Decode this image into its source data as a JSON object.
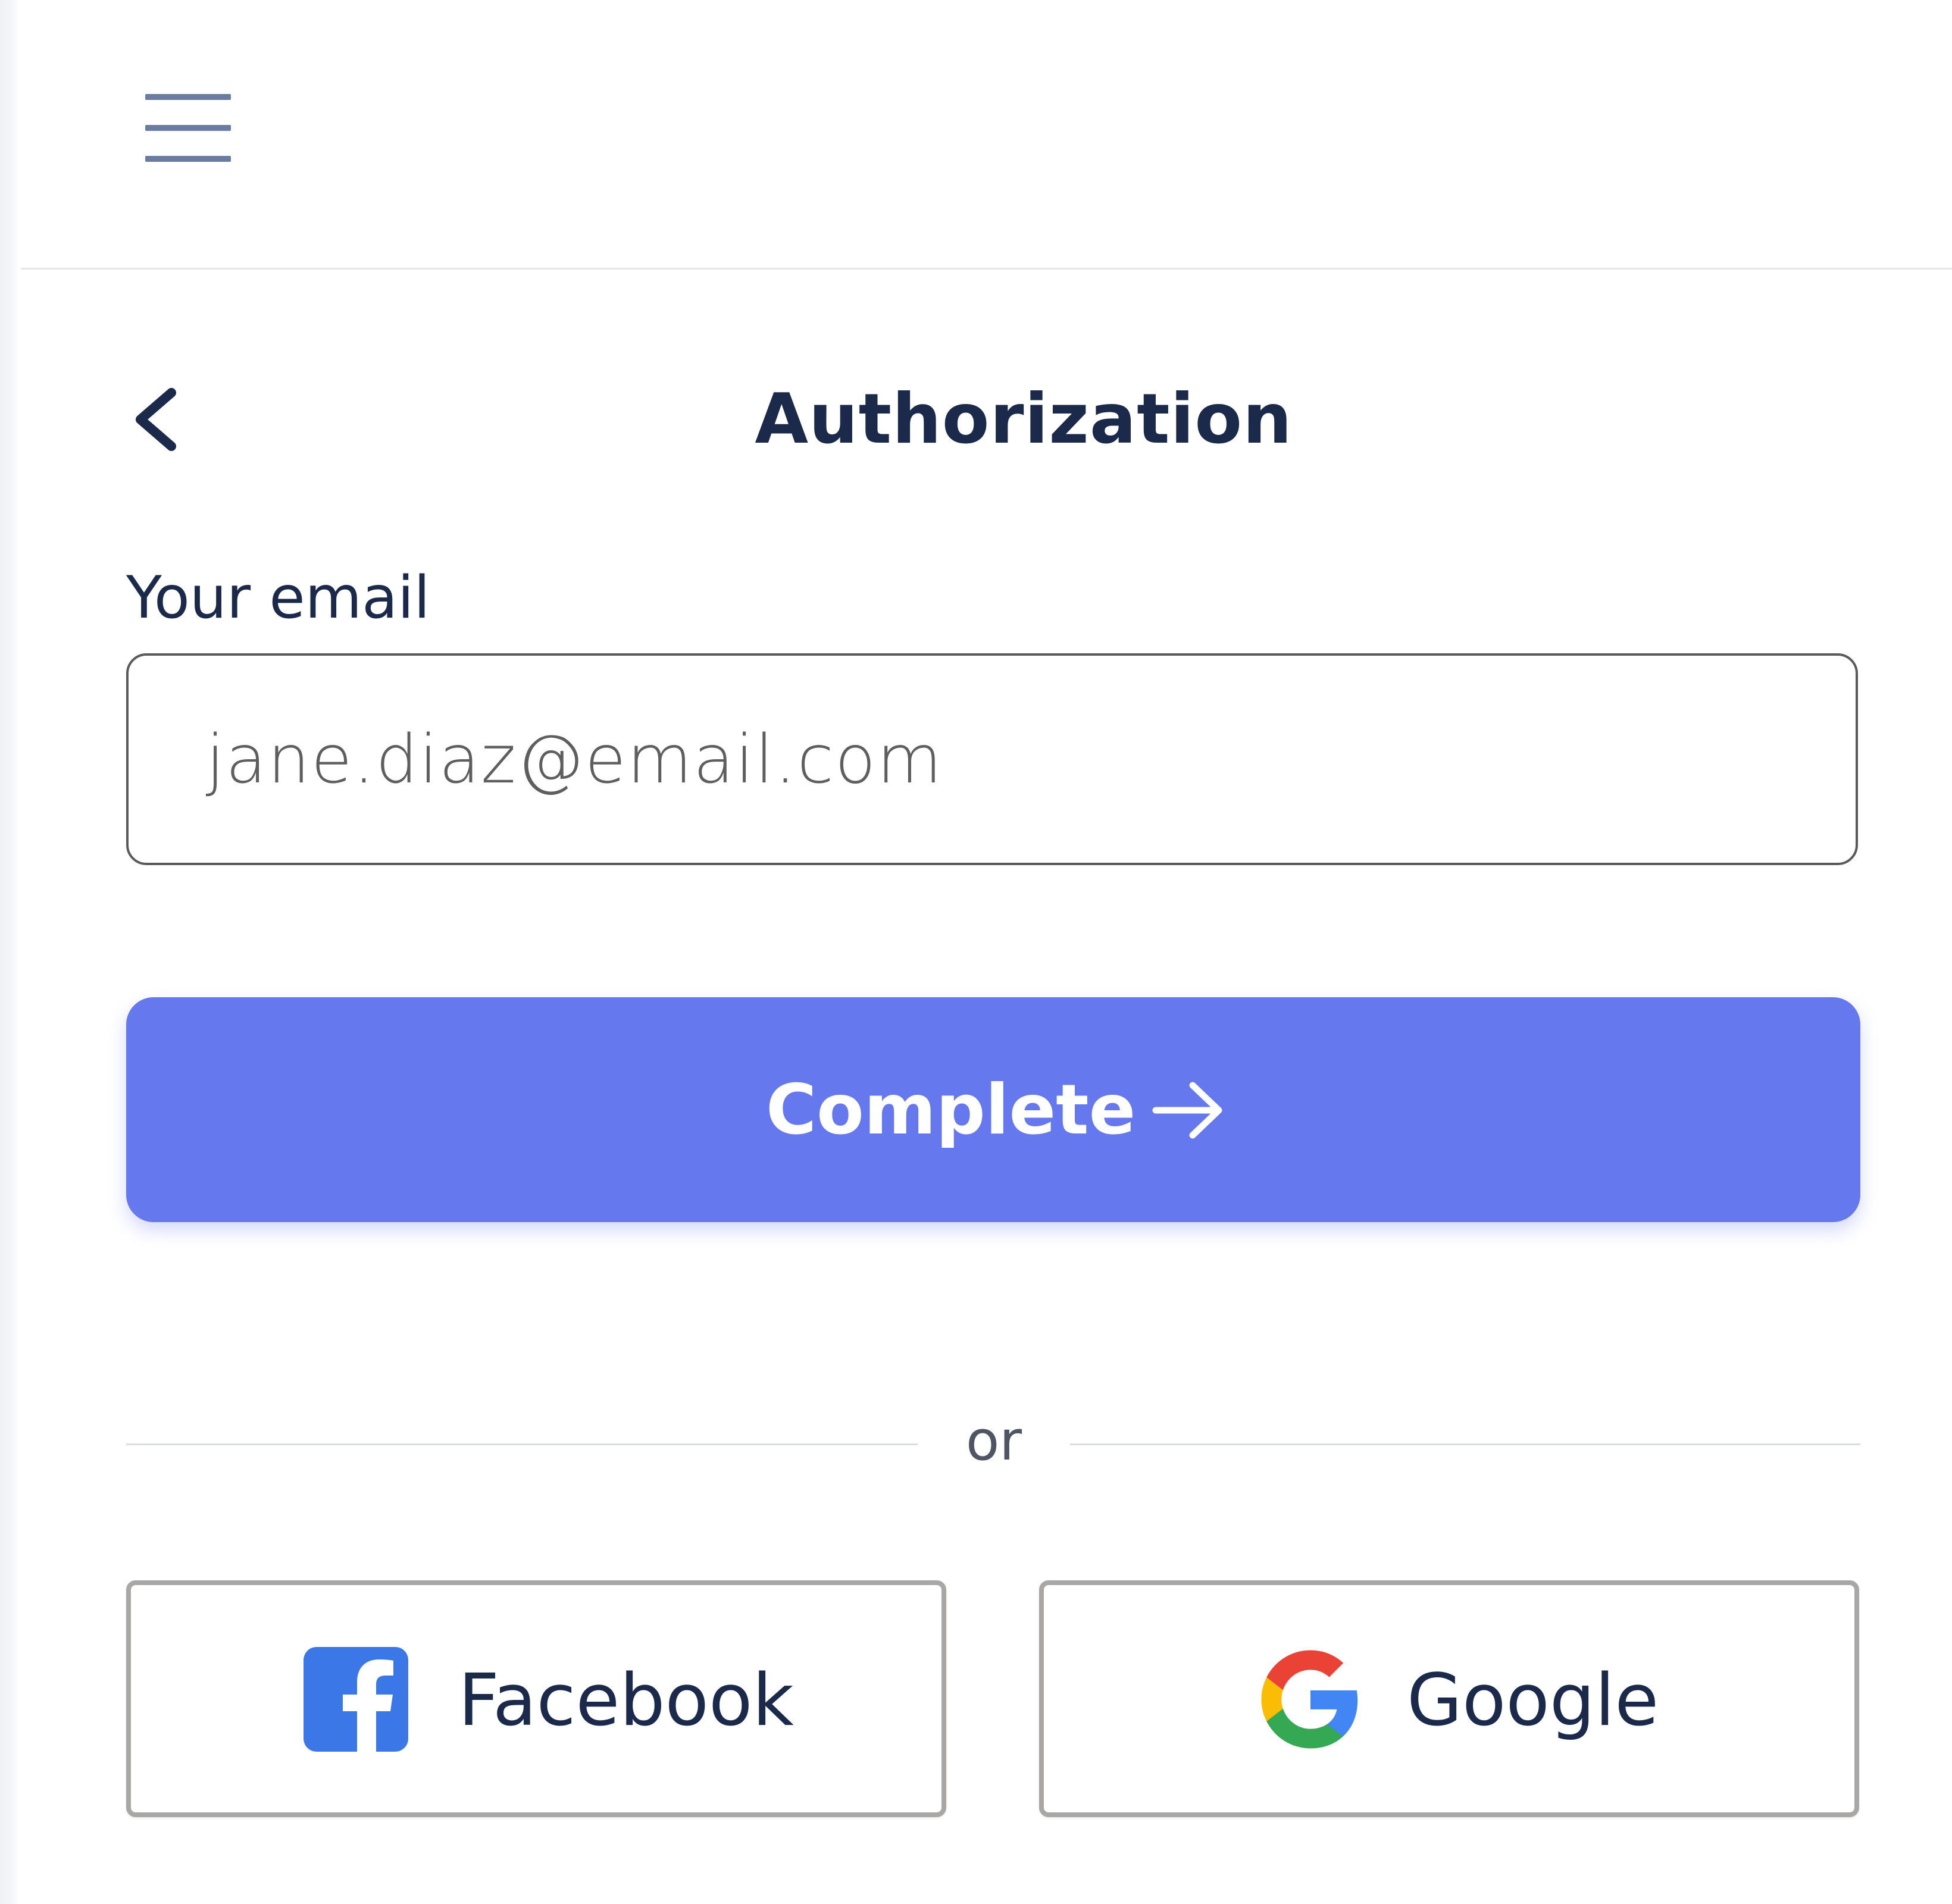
{
  "header": {
    "menu_icon": "hamburger-menu-icon"
  },
  "page": {
    "back_icon": "chevron-left-icon",
    "title": "Authorization"
  },
  "form": {
    "email_label": "Your email",
    "email_value": "jane.diaz@email.com",
    "submit_label": "Complete",
    "submit_icon": "arrow-right-icon"
  },
  "separator": {
    "text": "or"
  },
  "social": {
    "facebook_label": "Facebook",
    "facebook_icon": "facebook-icon",
    "google_label": "Google",
    "google_icon": "google-icon"
  },
  "colors": {
    "primary": "#6578ee",
    "text_dark": "#1b2a4b",
    "menu_icon": "#6b7ca3",
    "facebook_blue": "#3b77e6"
  }
}
